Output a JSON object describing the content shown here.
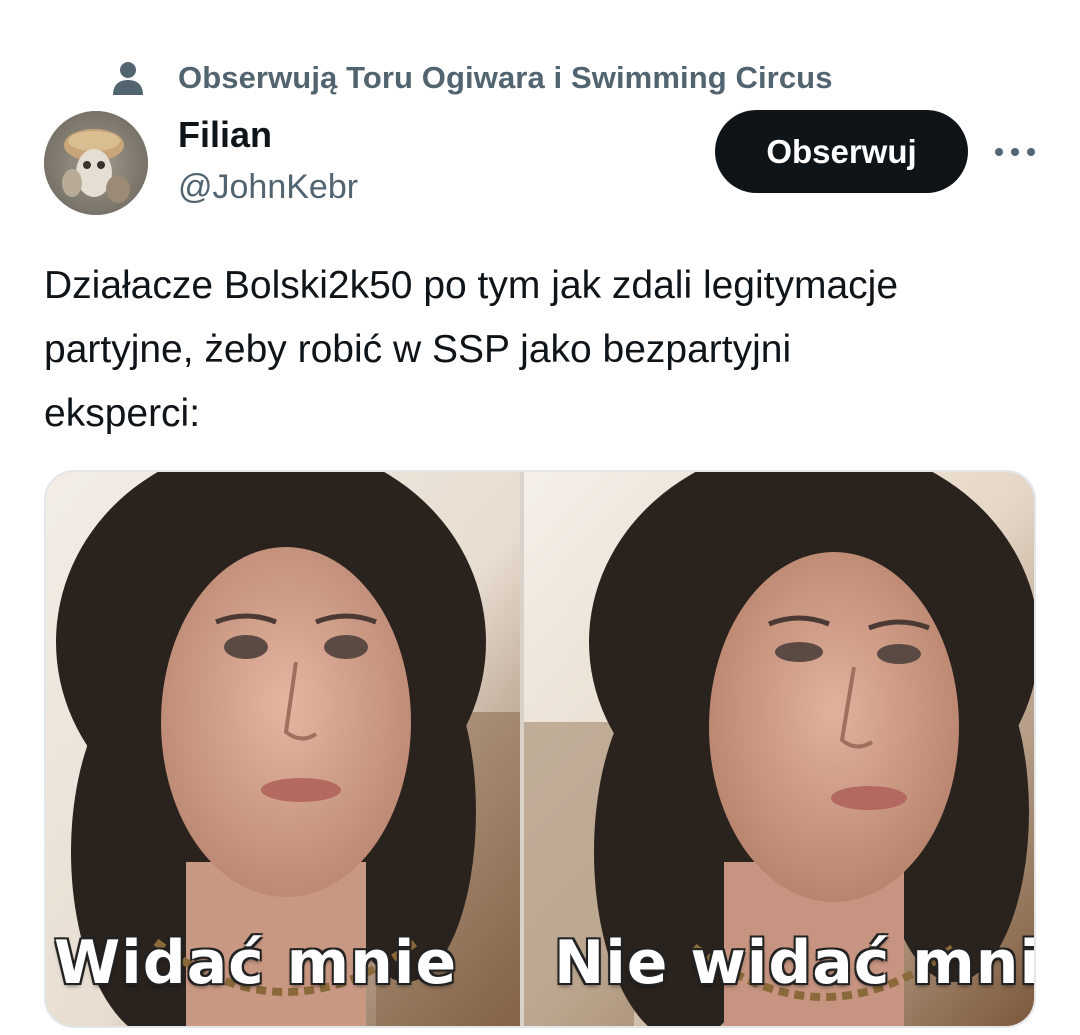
{
  "social_context": {
    "icon": "person-icon",
    "text": "Obserwują Toru Ogiwara i Swimming Circus"
  },
  "author": {
    "display_name": "Filian",
    "handle": "@JohnKebr",
    "avatar": "avatar"
  },
  "actions": {
    "follow_label": "Obserwuj",
    "more_icon": "more-icon"
  },
  "tweet": {
    "lines": [
      "Działacze Bolski2k50 po tym jak zdali legitymacje",
      "partyjne, żeby robić  w SSP jako bezpartyjni",
      "eksperci:"
    ]
  },
  "media": {
    "captions": {
      "left": "Widać mnie",
      "right": "Nie widać mnie"
    }
  },
  "colors": {
    "text_primary": "#0f1419",
    "text_secondary": "#536471",
    "button_bg": "#0f1419",
    "button_text": "#ffffff"
  }
}
